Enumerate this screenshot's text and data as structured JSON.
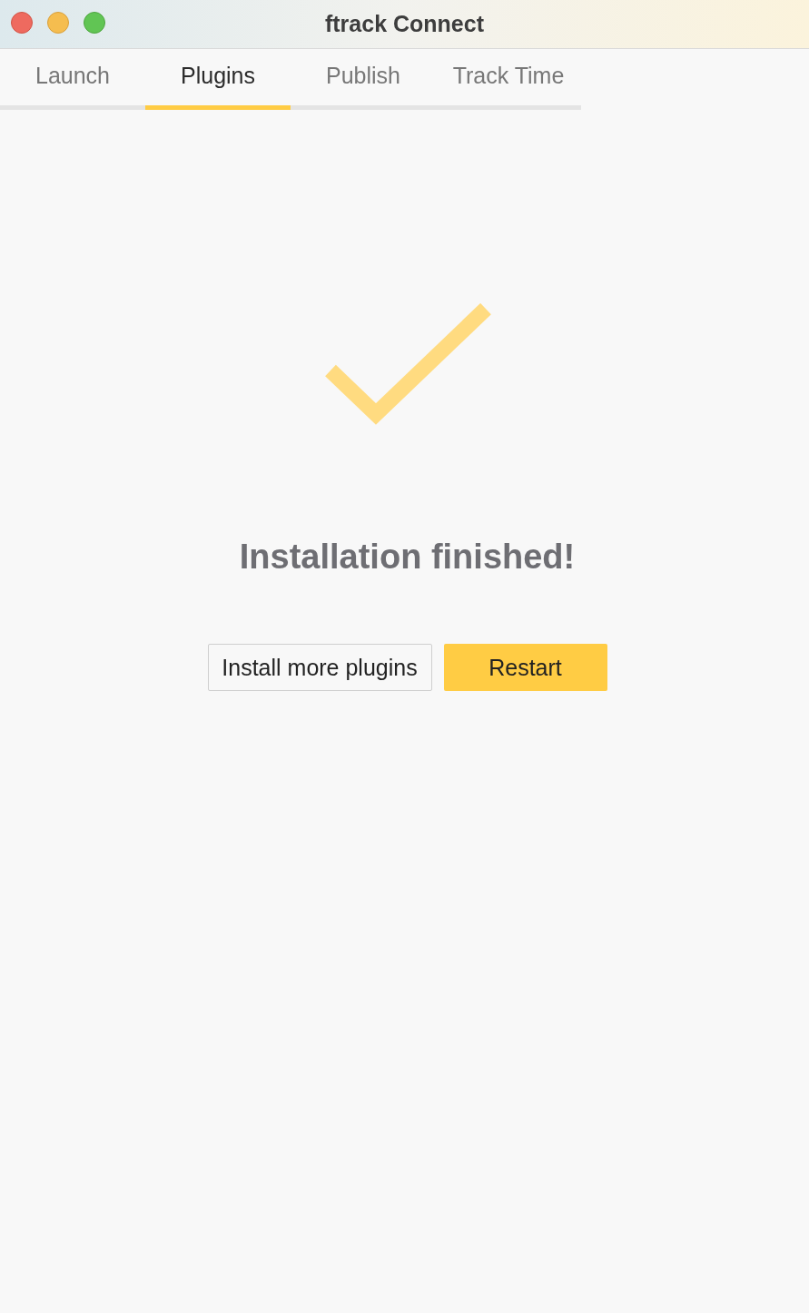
{
  "window": {
    "title": "ftrack Connect"
  },
  "tabs": [
    {
      "label": "Launch",
      "selected": false
    },
    {
      "label": "Plugins",
      "selected": true
    },
    {
      "label": "Publish",
      "selected": false
    },
    {
      "label": "Track Time",
      "selected": false
    }
  ],
  "message": "Installation finished!",
  "buttons": [
    {
      "label": "Install more plugins",
      "kind": "secondary"
    },
    {
      "label": "Restart",
      "kind": "primary"
    }
  ]
}
